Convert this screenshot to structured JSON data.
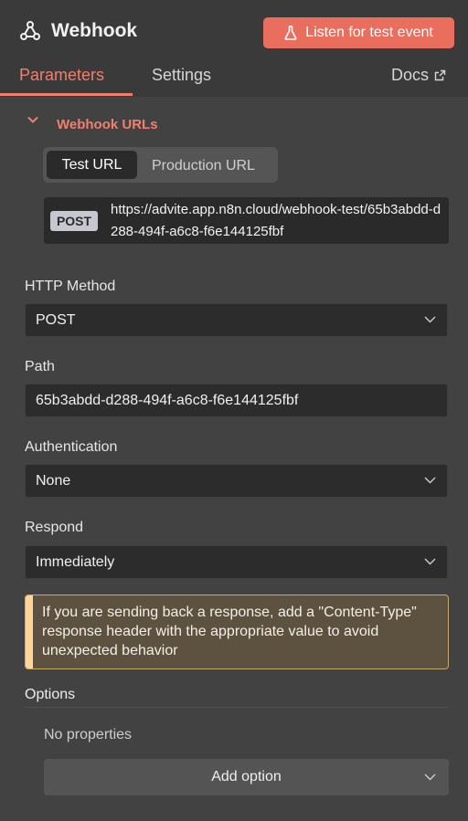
{
  "header": {
    "title": "Webhook",
    "node_icon": "webhook-icon",
    "listen_button": {
      "label": "Listen for test event",
      "icon": "flask-icon"
    }
  },
  "tabs": {
    "parameters": "Parameters",
    "settings": "Settings",
    "docs": "Docs",
    "docs_icon": "external-link-icon",
    "active": "parameters"
  },
  "webhook_urls": {
    "section_title": "Webhook URLs",
    "toggle": {
      "test": "Test URL",
      "production": "Production URL",
      "selected": "test"
    },
    "method": "POST",
    "url": "https://advite.app.n8n.cloud/webhook-test/65b3abdd-d288-494f-a6c8-f6e144125fbf"
  },
  "fields": {
    "http_method": {
      "label": "HTTP Method",
      "value": "POST"
    },
    "path": {
      "label": "Path",
      "value": "65b3abdd-d288-494f-a6c8-f6e144125fbf"
    },
    "authentication": {
      "label": "Authentication",
      "value": "None"
    },
    "respond": {
      "label": "Respond",
      "value": "Immediately"
    }
  },
  "notice": {
    "text": "If you are sending back a response, add a \"Content-Type\" response header with the appropriate value to avoid unexpected behavior"
  },
  "options": {
    "label": "Options",
    "empty_text": "No properties",
    "add_button": "Add option"
  },
  "colors": {
    "accent": "#f07f6e",
    "button": "#ea6e5e",
    "background": "#424242",
    "notice_bg": "#5d5240",
    "notice_border": "#ffd59a"
  }
}
